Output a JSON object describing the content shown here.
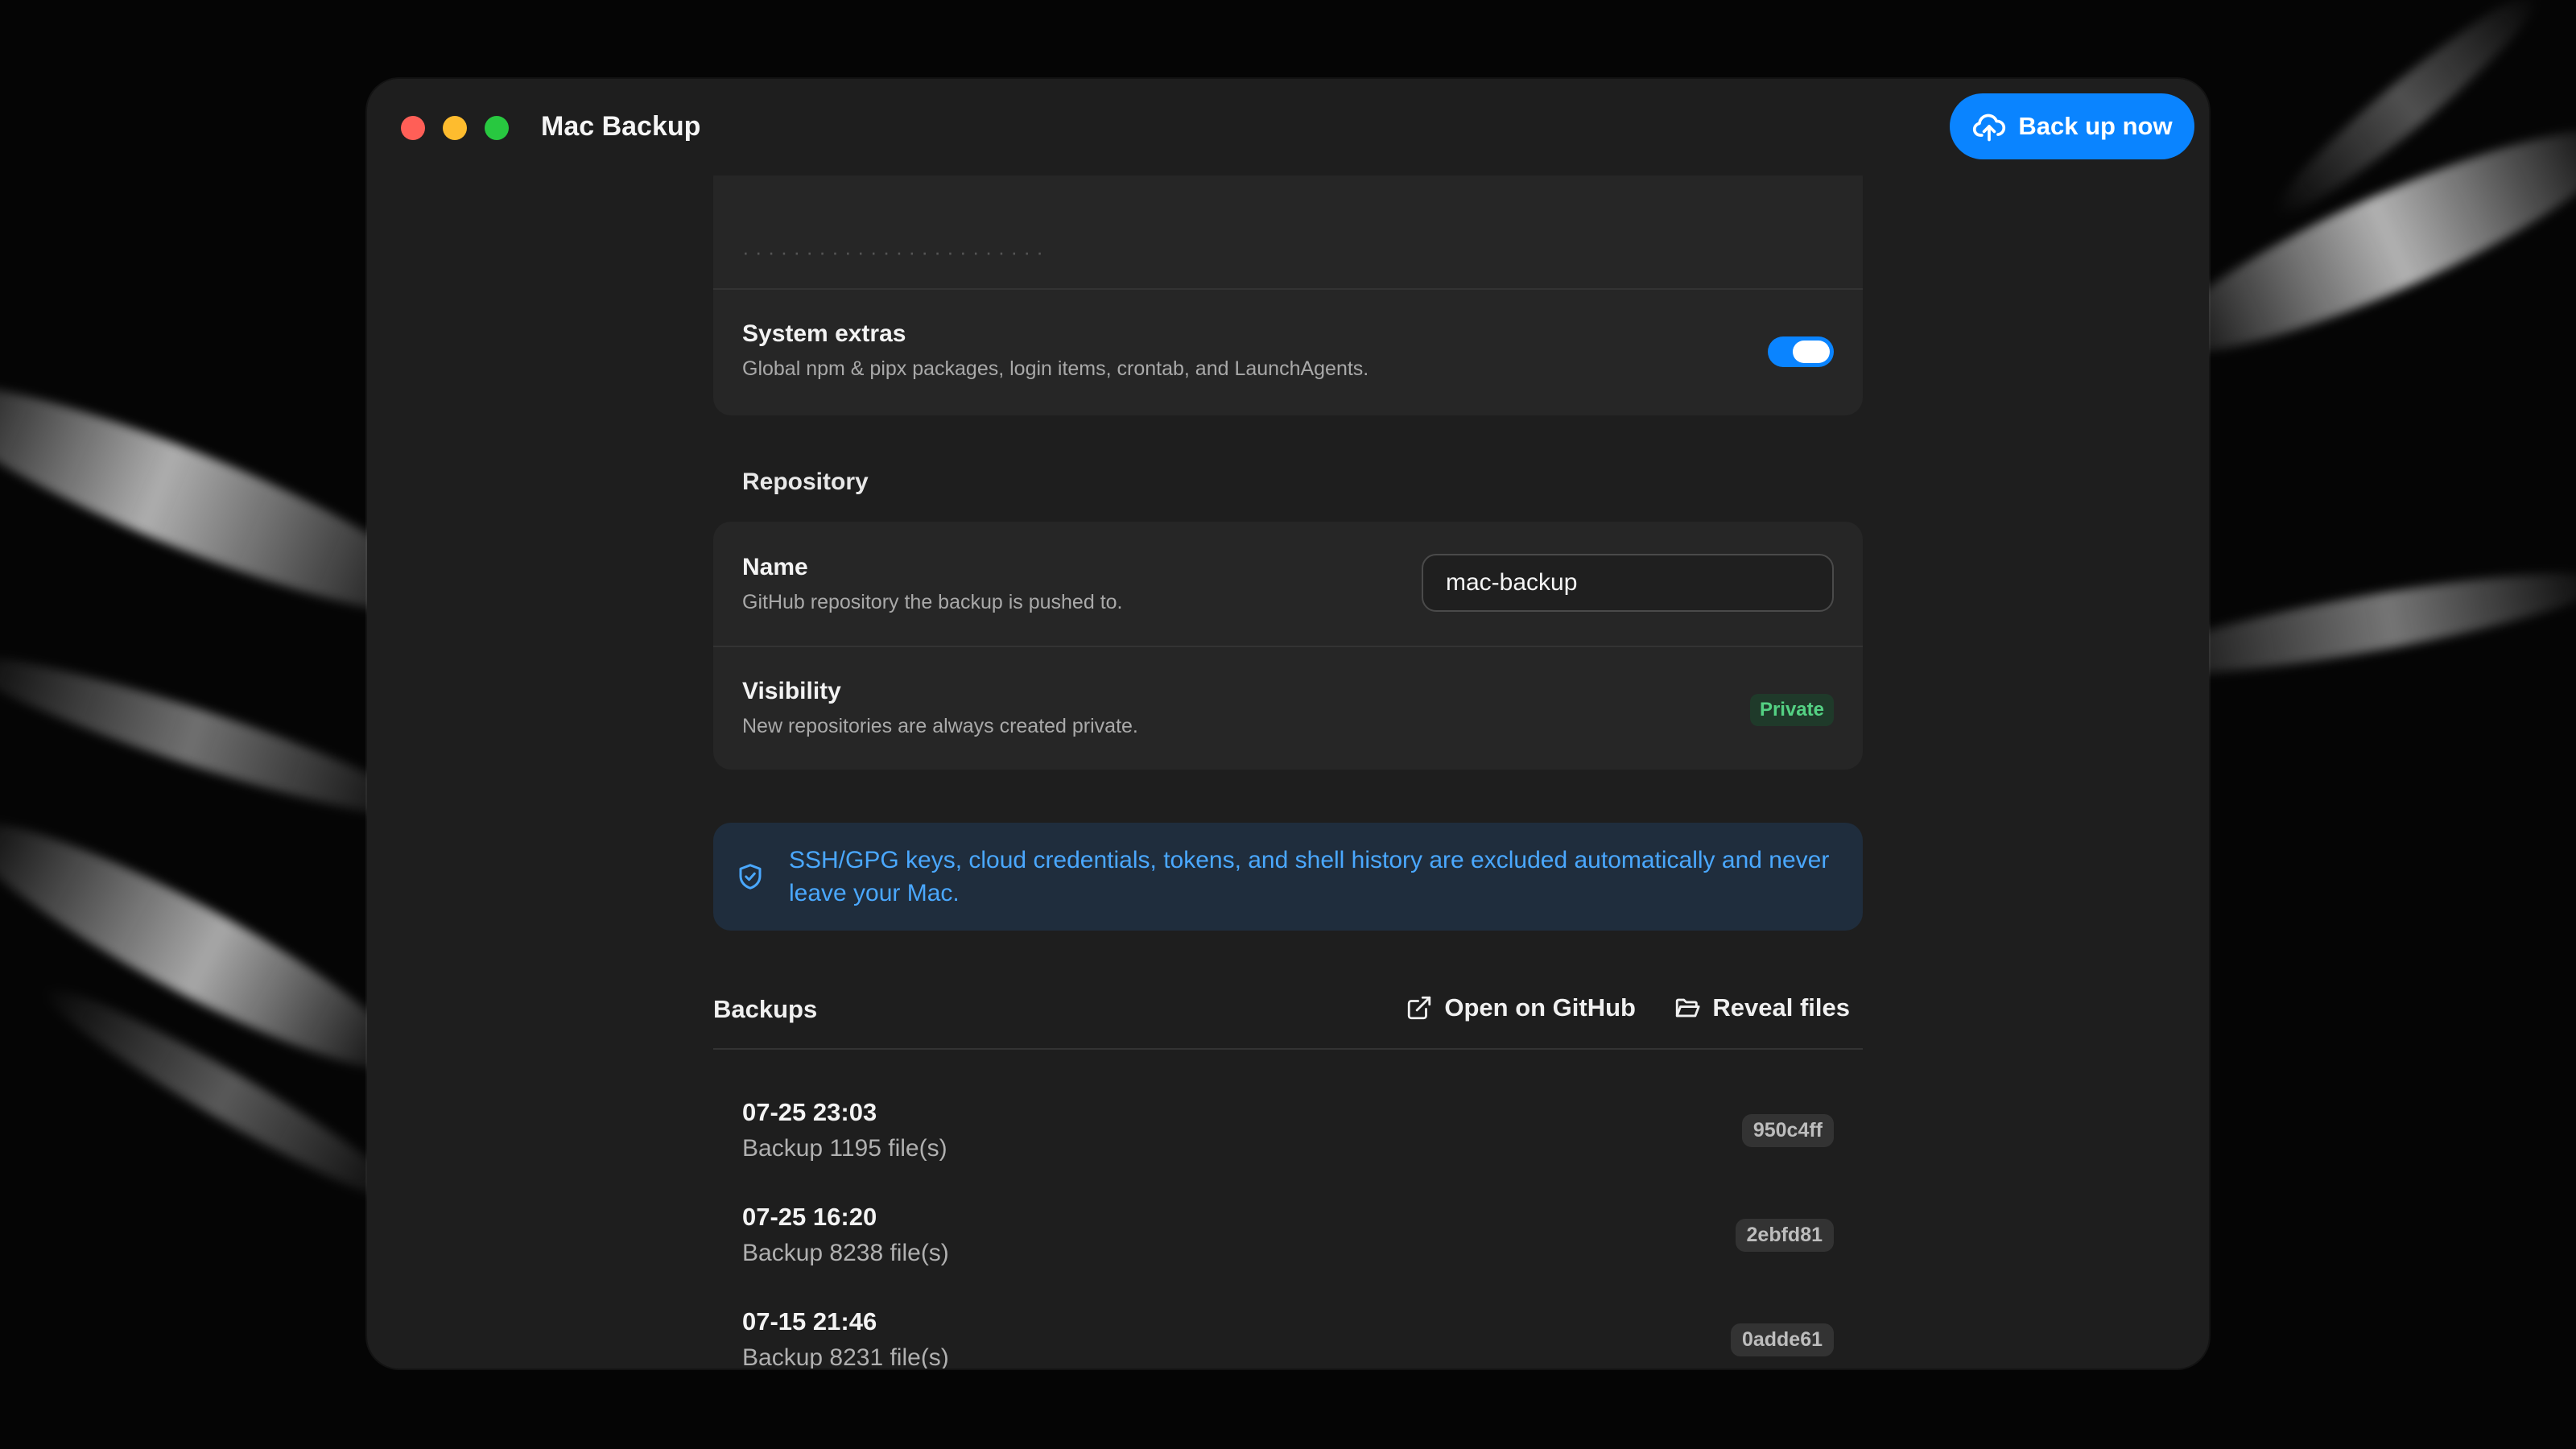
{
  "window": {
    "title": "Mac Backup",
    "primary_action": {
      "label": "Back up now",
      "icon": "cloud-upload-icon"
    }
  },
  "settings": {
    "system_extras": {
      "title": "System extras",
      "description": "Global npm & pipx packages, login items, crontab, and LaunchAgents.",
      "enabled": true
    }
  },
  "repository": {
    "section_label": "Repository",
    "name": {
      "title": "Name",
      "description": "GitHub repository the backup is pushed to.",
      "value": "mac-backup"
    },
    "visibility": {
      "title": "Visibility",
      "description": "New repositories are always created private.",
      "badge": "Private"
    }
  },
  "notice": {
    "icon": "shield-icon",
    "text": "SSH/GPG keys, cloud credentials, tokens, and shell history are excluded automatically and never leave your Mac."
  },
  "backups": {
    "section_label": "Backups",
    "actions": {
      "open_github": "Open on GitHub",
      "reveal_files": "Reveal files"
    },
    "items": [
      {
        "date": "07-25 23:03",
        "summary": "Backup 1195 file(s)",
        "hash": "950c4ff"
      },
      {
        "date": "07-25 16:20",
        "summary": "Backup 8238 file(s)",
        "hash": "2ebfd81"
      },
      {
        "date": "07-15 21:46",
        "summary": "Backup 8231 file(s)",
        "hash": "0adde61"
      }
    ]
  },
  "colors": {
    "accent": "#0a84ff",
    "success": "#54d183",
    "notice_text": "#4aa8ff"
  }
}
